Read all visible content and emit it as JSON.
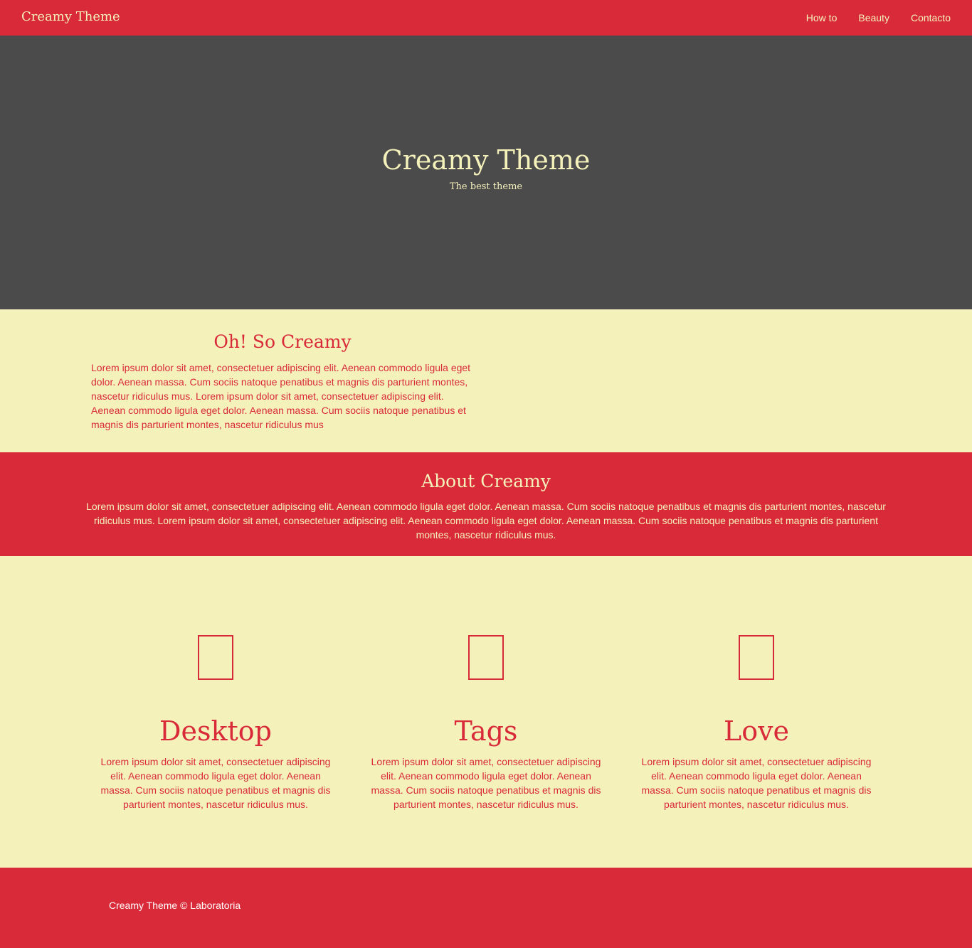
{
  "colors": {
    "primary": "#d92a39",
    "cream": "#f4f1bb",
    "hero_bg": "#4b4b4b"
  },
  "navbar": {
    "brand": "Creamy Theme",
    "links": [
      "How to",
      "Beauty",
      "Contacto"
    ]
  },
  "hero": {
    "title": "Creamy Theme",
    "subtitle": "The best theme"
  },
  "intro": {
    "title": "Oh! So Creamy",
    "text": "Lorem ipsum dolor sit amet, consectetuer adipiscing elit. Aenean commodo ligula eget dolor. Aenean massa. Cum sociis natoque penatibus et magnis dis parturient montes, nascetur ridiculus mus. Lorem ipsum dolor sit amet, consectetuer adipiscing elit. Aenean commodo ligula eget dolor. Aenean massa. Cum sociis natoque penatibus et magnis dis parturient montes, nascetur ridiculus mus"
  },
  "about": {
    "title": "About Creamy",
    "text": "Lorem ipsum dolor sit amet, consectetuer adipiscing elit. Aenean commodo ligula eget dolor. Aenean massa. Cum sociis natoque penatibus et magnis dis parturient montes, nascetur ridiculus mus. Lorem ipsum dolor sit amet, consectetuer adipiscing elit. Aenean commodo ligula eget dolor. Aenean massa. Cum sociis natoque penatibus et magnis dis parturient montes, nascetur ridiculus mus."
  },
  "features": [
    {
      "icon": "missing-glyph-icon",
      "title": "Desktop",
      "text": "Lorem ipsum dolor sit amet, consectetuer adipiscing elit. Aenean commodo ligula eget dolor. Aenean massa. Cum sociis natoque penatibus et magnis dis parturient montes, nascetur ridiculus mus."
    },
    {
      "icon": "missing-glyph-icon",
      "title": "Tags",
      "text": "Lorem ipsum dolor sit amet, consectetuer adipiscing elit. Aenean commodo ligula eget dolor. Aenean massa. Cum sociis natoque penatibus et magnis dis parturient montes, nascetur ridiculus mus."
    },
    {
      "icon": "missing-glyph-icon",
      "title": "Love",
      "text": "Lorem ipsum dolor sit amet, consectetuer adipiscing elit. Aenean commodo ligula eget dolor. Aenean massa. Cum sociis natoque penatibus et magnis dis parturient montes, nascetur ridiculus mus."
    }
  ],
  "footer": {
    "text": "Creamy Theme © Laboratoria"
  }
}
